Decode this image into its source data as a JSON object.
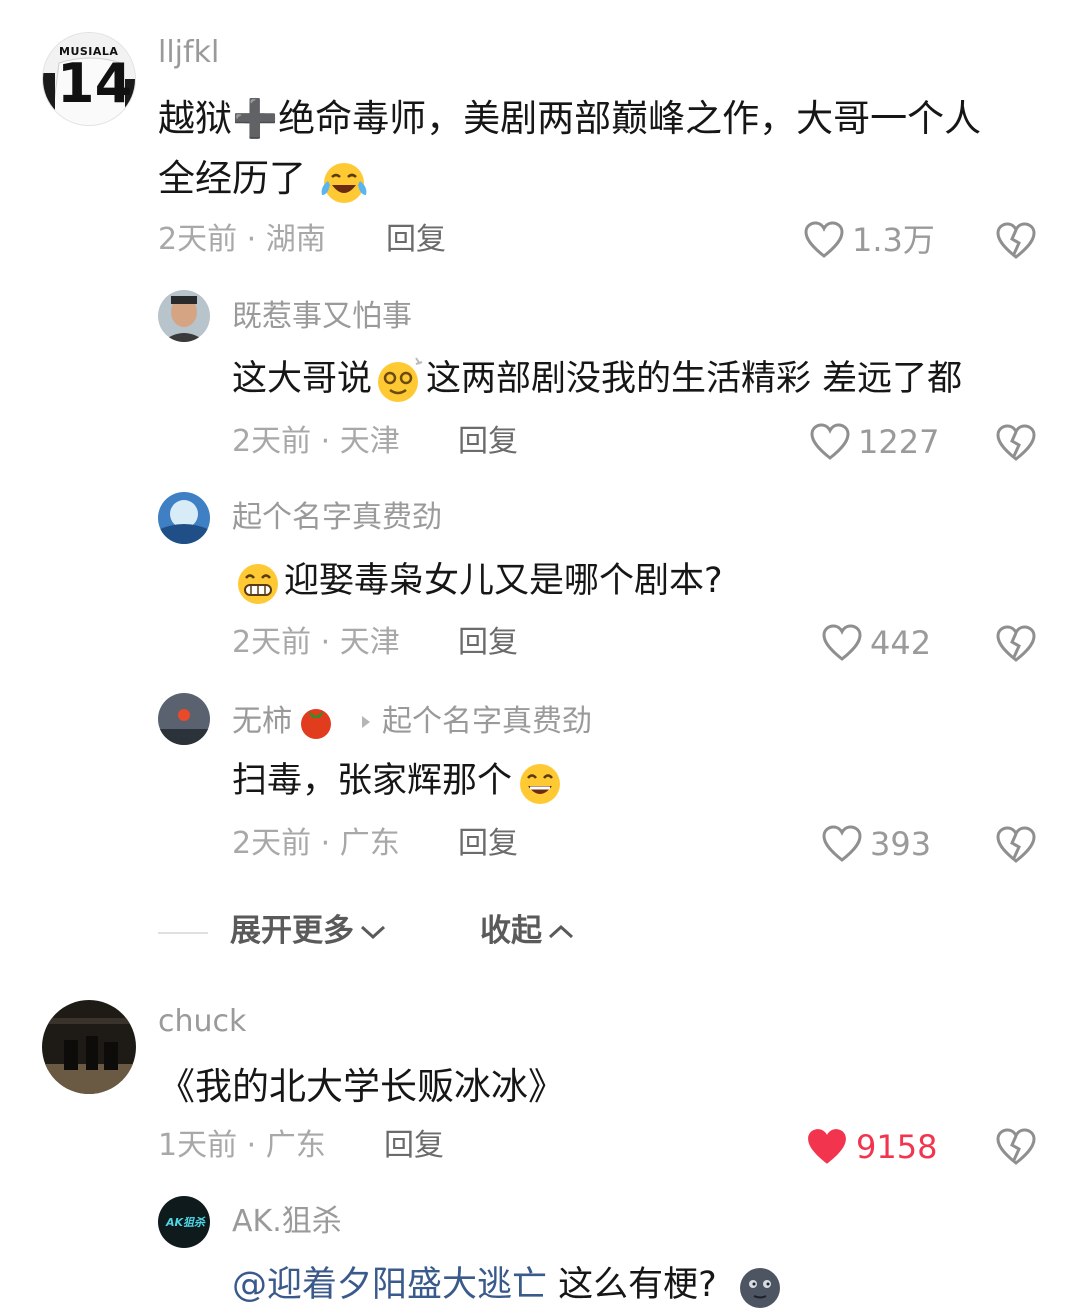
{
  "comments": [
    {
      "username": "lljfkl",
      "avatar_jersey_name": "MUSIALA",
      "avatar_jersey_number": "14",
      "text_line1": "越狱➕绝命毒师，美剧两部巅峰之作，大哥一个人",
      "text_line2": "全经历了",
      "time": "2天前",
      "location": "湖南",
      "reply": "回复",
      "likes": "1.3万",
      "replies": [
        {
          "username": "既惹事又怕事",
          "text_a": "这大哥说",
          "text_b": "这两部剧没我的生活精彩 差远了都",
          "time": "2天前",
          "location": "天津",
          "reply": "回复",
          "likes": "1227"
        },
        {
          "username": "起个名字真费劲",
          "text_a": "",
          "text_b": "迎娶毒枭女儿又是哪个剧本?",
          "time": "2天前",
          "location": "天津",
          "reply": "回复",
          "likes": "442"
        },
        {
          "username": "无柿",
          "reply_to": "起个名字真费劲",
          "text_a": "扫毒，张家辉那个",
          "text_b": "",
          "time": "2天前",
          "location": "广东",
          "reply": "回复",
          "likes": "393"
        }
      ],
      "expand_more": "展开更多",
      "collapse": "收起"
    },
    {
      "username": "chuck",
      "text_line1": "《我的北大学长贩冰冰》",
      "time": "1天前",
      "location": "广东",
      "reply": "回复",
      "likes": "9158",
      "liked": true,
      "replies": [
        {
          "username": "AK.狙杀",
          "avatar_label": "AK狙杀",
          "mention": "@迎着夕阳盛大逃亡",
          "text_b": " 这么有梗?",
          "time": "",
          "location": "",
          "reply": "",
          "likes": ""
        }
      ]
    }
  ],
  "icons": {
    "like": "heart-outline-icon",
    "liked": "heart-filled-icon",
    "dislike": "broken-heart-icon",
    "chevron_down": "chevron-down-icon",
    "chevron_up": "chevron-up-icon"
  },
  "colors": {
    "liked": "#f2344f",
    "meta": "#a8a8a8",
    "mention": "#3a5a8c"
  }
}
